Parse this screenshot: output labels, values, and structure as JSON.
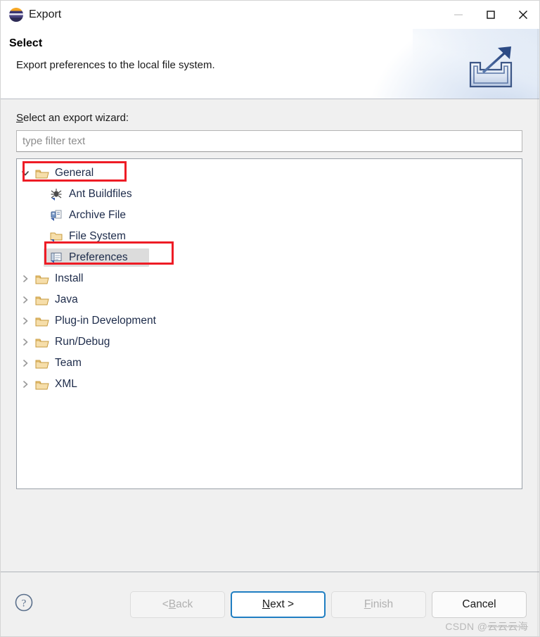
{
  "window": {
    "title": "Export",
    "app_icon": "eclipse-logo-icon",
    "controls": {
      "minimize": "minimize-icon",
      "maximize": "maximize-icon",
      "close": "close-icon"
    }
  },
  "header": {
    "title": "Select",
    "description": "Export preferences to the local file system.",
    "icon": "export-tray-arrow-icon"
  },
  "main": {
    "wizard_label_prefix": "S",
    "wizard_label_rest": "elect an export wizard:",
    "filter": {
      "value": "",
      "placeholder": "type filter text"
    },
    "tree": [
      {
        "label": "General",
        "icon": "open-folder-icon",
        "expanded": true,
        "level": 0,
        "has_children": true,
        "annotated": true
      },
      {
        "label": "Ant Buildfiles",
        "icon": "ant-buildfile-icon",
        "level": 1,
        "has_children": false,
        "selected": false
      },
      {
        "label": "Archive File",
        "icon": "archive-file-icon",
        "level": 1,
        "has_children": false,
        "selected": false
      },
      {
        "label": "File System",
        "icon": "folder-icon",
        "level": 1,
        "has_children": false,
        "selected": false
      },
      {
        "label": "Preferences",
        "icon": "preferences-icon",
        "level": 1,
        "has_children": false,
        "selected": true,
        "annotated": true
      },
      {
        "label": "Install",
        "icon": "open-folder-icon",
        "expanded": false,
        "level": 0,
        "has_children": true
      },
      {
        "label": "Java",
        "icon": "open-folder-icon",
        "expanded": false,
        "level": 0,
        "has_children": true
      },
      {
        "label": "Plug-in Development",
        "icon": "open-folder-icon",
        "expanded": false,
        "level": 0,
        "has_children": true
      },
      {
        "label": "Run/Debug",
        "icon": "open-folder-icon",
        "expanded": false,
        "level": 0,
        "has_children": true
      },
      {
        "label": "Team",
        "icon": "open-folder-icon",
        "expanded": false,
        "level": 0,
        "has_children": true
      },
      {
        "label": "XML",
        "icon": "open-folder-icon",
        "expanded": false,
        "level": 0,
        "has_children": true
      }
    ]
  },
  "footer": {
    "help_icon": "help-question-icon",
    "buttons": [
      {
        "name": "back",
        "prefix": "< ",
        "mnemonic": "B",
        "suffix": "ack",
        "enabled": false,
        "focused": false
      },
      {
        "name": "next",
        "prefix": "",
        "mnemonic": "N",
        "suffix": "ext >",
        "enabled": true,
        "focused": true
      },
      {
        "name": "finish",
        "prefix": "",
        "mnemonic": "F",
        "suffix": "inish",
        "enabled": false,
        "focused": false
      },
      {
        "name": "cancel",
        "prefix": "",
        "mnemonic": "",
        "suffix": "Cancel",
        "enabled": true,
        "focused": false
      }
    ]
  },
  "watermark": {
    "prefix": "CSDN @",
    "author": "云云云海"
  },
  "colors": {
    "annotation": "#ee1c25",
    "focus_border": "#1f7ec2",
    "selection_bg": "#dcdcdc",
    "tree_text": "#1d2b4a",
    "dialog_bg": "#f0f0f0",
    "folder": "#e8bb6d"
  }
}
